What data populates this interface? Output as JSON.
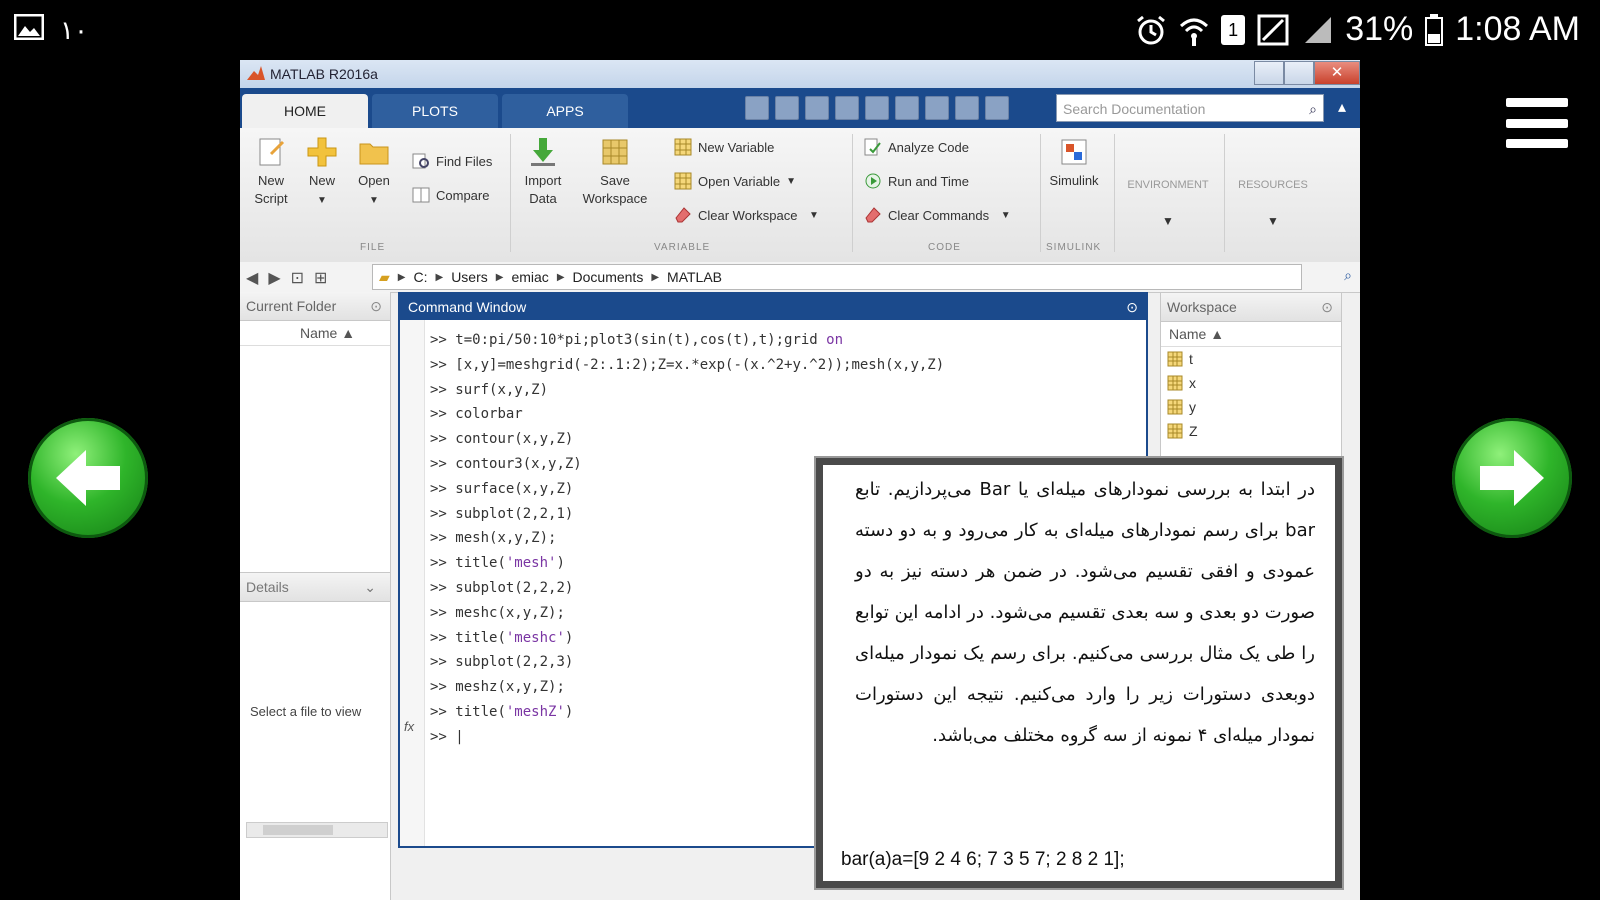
{
  "status_bar": {
    "left_number": "١٠",
    "battery": "31%",
    "time": "1:08 AM",
    "sim_label": "1"
  },
  "window": {
    "title": "MATLAB R2016a",
    "close_glyph": "✕"
  },
  "tabs": [
    {
      "label": "HOME",
      "active": true
    },
    {
      "label": "PLOTS",
      "active": false
    },
    {
      "label": "APPS",
      "active": false
    }
  ],
  "search": {
    "placeholder": "Search Documentation"
  },
  "ribbon": {
    "file": {
      "new_script": "New Script",
      "new": "New",
      "open": "Open",
      "find_files": "Find Files",
      "compare": "Compare",
      "section": "FILE"
    },
    "variable": {
      "import_data": "Import Data",
      "save_workspace": "Save Workspace",
      "new_variable": "New Variable",
      "open_variable": "Open Variable",
      "clear_workspace": "Clear Workspace",
      "section": "VARIABLE"
    },
    "code": {
      "analyze_code": "Analyze Code",
      "run_and_time": "Run and Time",
      "clear_commands": "Clear Commands",
      "section": "CODE"
    },
    "simulink": {
      "label": "Simulink",
      "section": "SIMULINK"
    },
    "environment": "ENVIRONMENT",
    "resources": "RESOURCES"
  },
  "address": {
    "crumbs": [
      "C:",
      "Users",
      "emiac",
      "Documents",
      "MATLAB"
    ]
  },
  "current_folder": {
    "title": "Current Folder",
    "name_col": "Name ▲",
    "details_title": "Details",
    "details_msg": "Select a file to view"
  },
  "command_window": {
    "title": "Command Window",
    "lines": [
      {
        "prompt": ">> ",
        "code": "t=0:pi/50:10*pi;plot3(sin(t),cos(t),t);grid ",
        "kw": "on"
      },
      {
        "prompt": ">> ",
        "code": "[x,y]=meshgrid(-2:.1:2);Z=x.*exp(-(x.^2+y.^2));mesh(x,y,Z)",
        "kw": ""
      },
      {
        "prompt": ">> ",
        "code": "surf(x,y,Z)",
        "kw": ""
      },
      {
        "prompt": ">> ",
        "code": "colorbar",
        "kw": ""
      },
      {
        "prompt": ">> ",
        "code": "contour(x,y,Z)",
        "kw": ""
      },
      {
        "prompt": ">> ",
        "code": "contour3(x,y,Z)",
        "kw": ""
      },
      {
        "prompt": ">> ",
        "code": "surface(x,y,Z)",
        "kw": ""
      },
      {
        "prompt": ">> ",
        "code": "subplot(2,2,1)",
        "kw": ""
      },
      {
        "prompt": ">> ",
        "code": "mesh(x,y,Z);",
        "kw": ""
      },
      {
        "prompt": ">> ",
        "code": "title(",
        "kw": "'mesh'",
        "tail": ")"
      },
      {
        "prompt": ">> ",
        "code": "subplot(2,2,2)",
        "kw": ""
      },
      {
        "prompt": ">> ",
        "code": "meshc(x,y,Z);",
        "kw": ""
      },
      {
        "prompt": ">> ",
        "code": "title(",
        "kw": "'meshc'",
        "tail": ")"
      },
      {
        "prompt": ">> ",
        "code": "subplot(2,2,3)",
        "kw": ""
      },
      {
        "prompt": ">> ",
        "code": "meshz(x,y,Z);",
        "kw": ""
      },
      {
        "prompt": ">> ",
        "code": "title(",
        "kw": "'meshZ'",
        "tail": ")"
      },
      {
        "prompt": ">> ",
        "code": "|",
        "kw": ""
      }
    ],
    "fx": "fx"
  },
  "workspace": {
    "title": "Workspace",
    "name_col": "Name ▲",
    "vars": [
      "t",
      "x",
      "y",
      "Z"
    ]
  },
  "overlay": {
    "text": "در ابتدا به بررسی نمودارهای میله‌ای یا Bar می‌پردازیم. تابع bar برای رسم نمودارهای میله‌ای به کار می‌رود و به دو دسته عمودی و افقی تقسیم می‌شود. در ضمن هر دسته نیز به دو صورت دو بعدی و سه بعدی تقسیم می‌شود. در ادامه این توابع را طی یک مثال بررسی می‌کنیم. برای رسم یک نمودار میله‌ای دوبعدی دستورات زیر را وارد می‌کنیم. نتیجه این دستورات نمودار میله‌ای ۴ نمونه از سه گروه مختلف می‌باشد.",
    "code": "bar(a)a=[9 2 4 6; 7 3 5 7; 2 8 2 1];"
  }
}
